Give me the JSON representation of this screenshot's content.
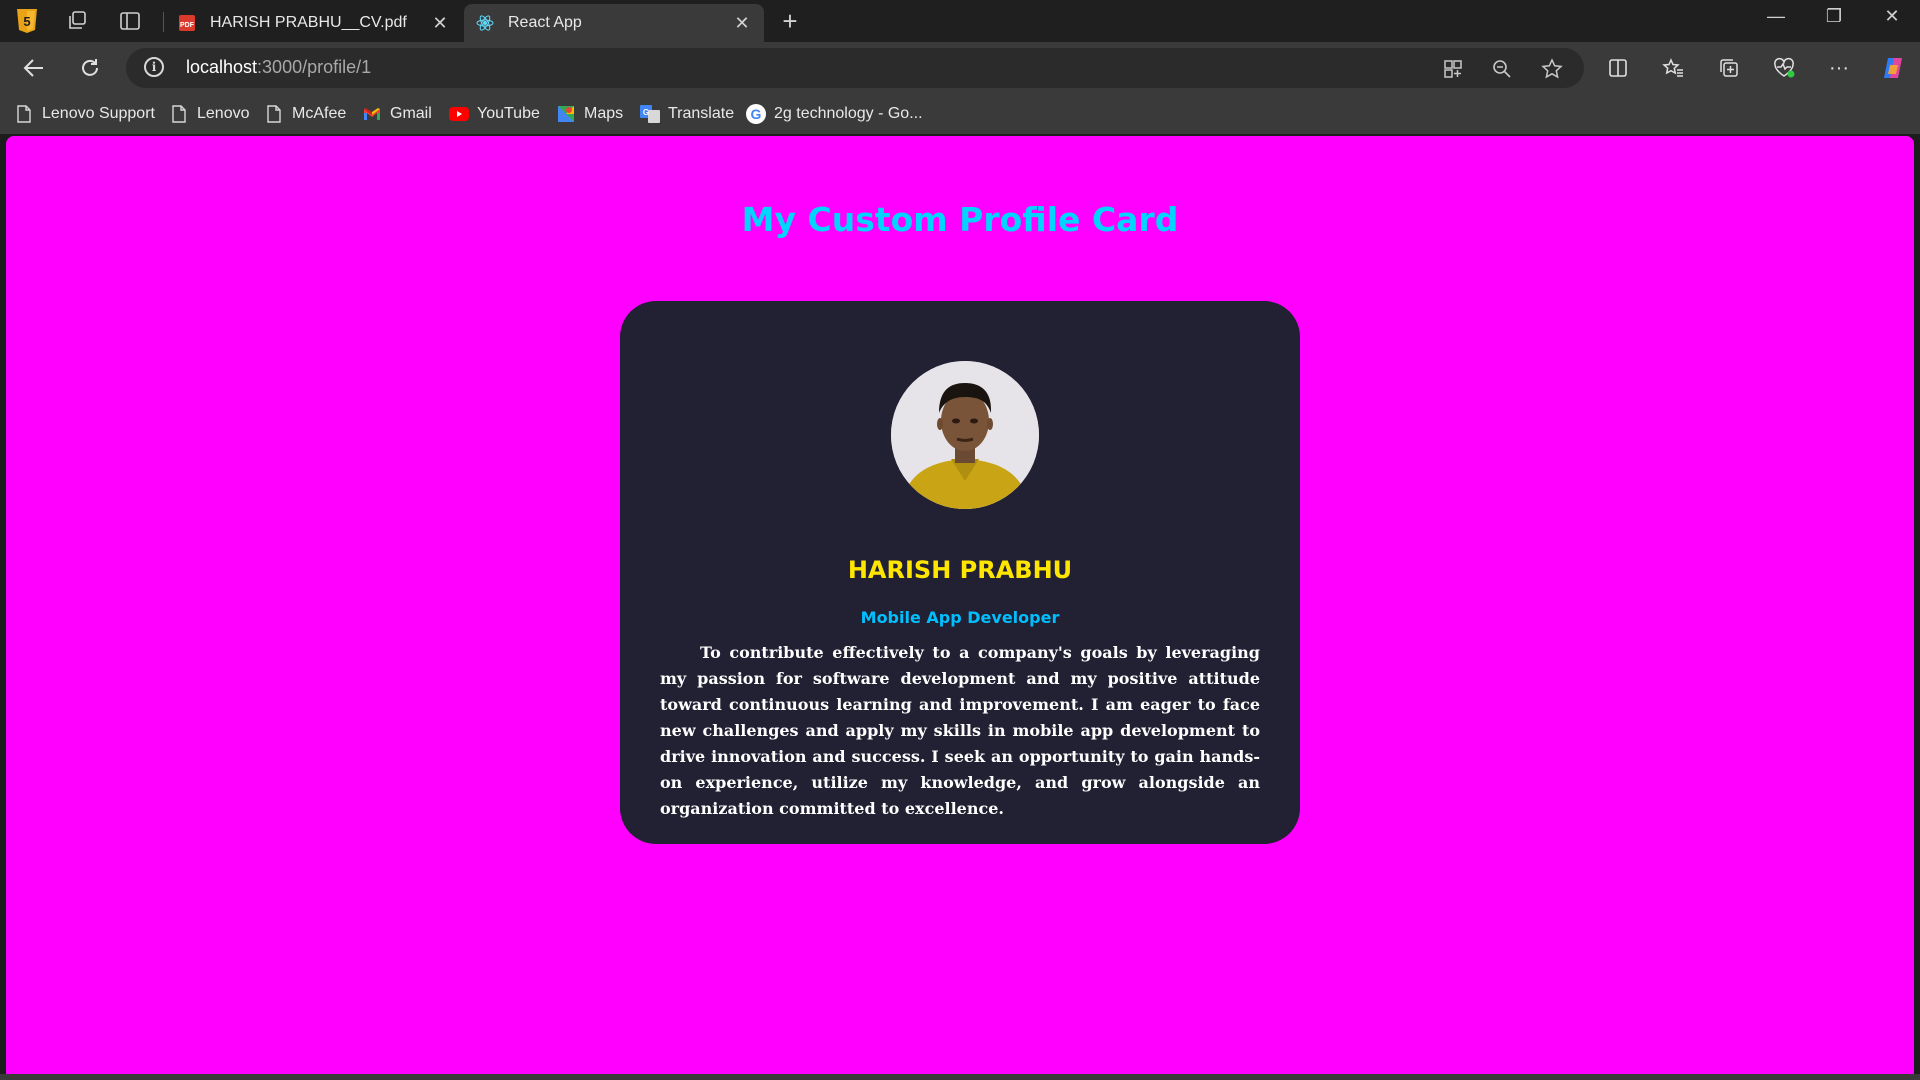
{
  "browser": {
    "tabs": [
      {
        "title": "HARISH PRABHU__CV.pdf",
        "icon": "pdf-icon",
        "active": false
      },
      {
        "title": "React App",
        "icon": "react-icon",
        "active": true
      }
    ],
    "address": {
      "host": "localhost",
      "path": ":3000/profile/1"
    },
    "bookmarks": [
      {
        "label": "Lenovo Support",
        "icon": "page-icon"
      },
      {
        "label": "Lenovo",
        "icon": "page-icon"
      },
      {
        "label": "McAfee",
        "icon": "page-icon"
      },
      {
        "label": "Gmail",
        "icon": "gmail-icon"
      },
      {
        "label": "YouTube",
        "icon": "youtube-icon"
      },
      {
        "label": "Maps",
        "icon": "maps-icon"
      },
      {
        "label": "Translate",
        "icon": "translate-icon"
      },
      {
        "label": "2g technology - Go...",
        "icon": "google-icon"
      }
    ]
  },
  "page": {
    "heading": "My Custom Profile Card",
    "background_color": "#ff00ff",
    "card": {
      "name": "HARISH PRABHU",
      "role": "Mobile App Developer",
      "bio": "To contribute effectively to a company's goals by leveraging my passion for software development and my positive attitude toward continuous learning and improvement. I am eager to face new challenges and apply my skills in mobile app development to drive innovation and success. I seek an opportunity to gain hands-on experience, utilize my knowledge, and grow alongside an organization committed to excellence.",
      "card_color": "#222033",
      "name_color": "#ffe600",
      "role_color": "#00bfff",
      "heading_color": "#00d4ff"
    }
  }
}
